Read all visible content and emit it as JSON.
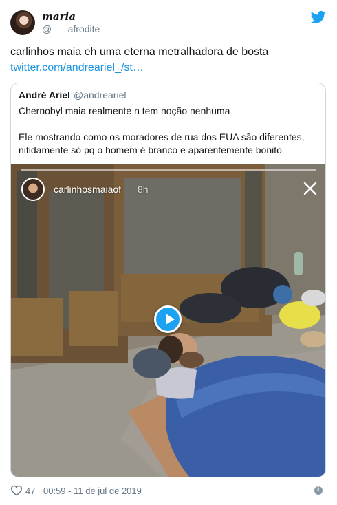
{
  "author": {
    "display_name": "maria",
    "handle": "@___afrodite"
  },
  "tweet": {
    "text": "carlinhos maia eh uma eterna metralhadora de bosta",
    "link": "twitter.com/andreariel_/st…"
  },
  "quoted_tweet": {
    "author_name": "André Ariel",
    "author_handle": "@andreariel_",
    "text_line1": "Chernobyl maia realmente n tem noção nenhuma",
    "text_line2": "Ele mostrando como os moradores de rua dos EUA são diferentes,",
    "text_line3": "nitidamente só pq o homem é branco e aparentemente bonito",
    "media": {
      "story_user": "carlinhosmaiaof",
      "story_time": "8h",
      "close_icon": "close-icon",
      "play_icon": "play-icon"
    }
  },
  "footer": {
    "likes": "47",
    "timestamp": "00:59 - 11 de jul de 2019",
    "heart_icon": "heart-icon",
    "info_icon": "info-icon"
  },
  "colors": {
    "link": "#1b95e0",
    "twitter_blue": "#1da1f2",
    "secondary_text": "#657786",
    "border": "#ccd6dd"
  }
}
